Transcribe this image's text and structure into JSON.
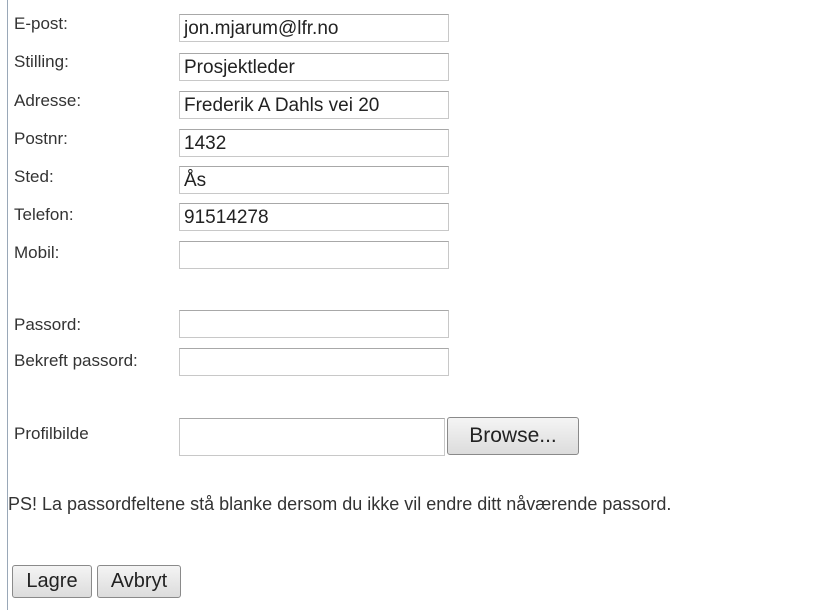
{
  "form": {
    "fields": [
      {
        "label": "E-post:",
        "value": "jon.mjarum@lfr.no"
      },
      {
        "label": "Stilling:",
        "value": "Prosjektleder"
      },
      {
        "label": "Adresse:",
        "value": "Frederik A Dahls vei 20"
      },
      {
        "label": "Postnr:",
        "value": "1432"
      },
      {
        "label": "Sted:",
        "value": "Ås"
      },
      {
        "label": "Telefon:",
        "value": "91514278"
      },
      {
        "label": "Mobil:",
        "value": ""
      }
    ],
    "password": {
      "label": "Passord:",
      "value": ""
    },
    "confirm_password": {
      "label": "Bekreft passord:",
      "value": ""
    },
    "profile_image": {
      "label": "Profilbilde",
      "browse_label": "Browse..."
    },
    "note": "PS! La passordfeltene stå blanke dersom du ikke vil endre ditt nåværende passord.",
    "buttons": {
      "save_label": "Lagre",
      "cancel_label": "Avbryt"
    }
  }
}
